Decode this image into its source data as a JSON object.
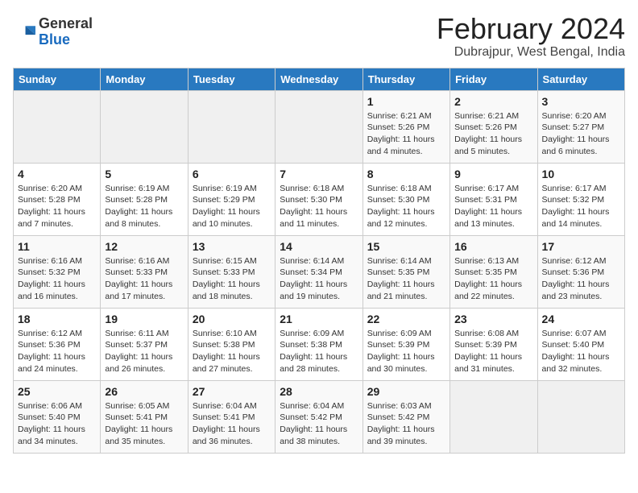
{
  "header": {
    "logo_general": "General",
    "logo_blue": "Blue",
    "title": "February 2024",
    "subtitle": "Dubrajpur, West Bengal, India"
  },
  "days_of_week": [
    "Sunday",
    "Monday",
    "Tuesday",
    "Wednesday",
    "Thursday",
    "Friday",
    "Saturday"
  ],
  "weeks": [
    [
      {
        "day": "",
        "info": ""
      },
      {
        "day": "",
        "info": ""
      },
      {
        "day": "",
        "info": ""
      },
      {
        "day": "",
        "info": ""
      },
      {
        "day": "1",
        "info": "Sunrise: 6:21 AM\nSunset: 5:26 PM\nDaylight: 11 hours and 4 minutes."
      },
      {
        "day": "2",
        "info": "Sunrise: 6:21 AM\nSunset: 5:26 PM\nDaylight: 11 hours and 5 minutes."
      },
      {
        "day": "3",
        "info": "Sunrise: 6:20 AM\nSunset: 5:27 PM\nDaylight: 11 hours and 6 minutes."
      }
    ],
    [
      {
        "day": "4",
        "info": "Sunrise: 6:20 AM\nSunset: 5:28 PM\nDaylight: 11 hours and 7 minutes."
      },
      {
        "day": "5",
        "info": "Sunrise: 6:19 AM\nSunset: 5:28 PM\nDaylight: 11 hours and 8 minutes."
      },
      {
        "day": "6",
        "info": "Sunrise: 6:19 AM\nSunset: 5:29 PM\nDaylight: 11 hours and 10 minutes."
      },
      {
        "day": "7",
        "info": "Sunrise: 6:18 AM\nSunset: 5:30 PM\nDaylight: 11 hours and 11 minutes."
      },
      {
        "day": "8",
        "info": "Sunrise: 6:18 AM\nSunset: 5:30 PM\nDaylight: 11 hours and 12 minutes."
      },
      {
        "day": "9",
        "info": "Sunrise: 6:17 AM\nSunset: 5:31 PM\nDaylight: 11 hours and 13 minutes."
      },
      {
        "day": "10",
        "info": "Sunrise: 6:17 AM\nSunset: 5:32 PM\nDaylight: 11 hours and 14 minutes."
      }
    ],
    [
      {
        "day": "11",
        "info": "Sunrise: 6:16 AM\nSunset: 5:32 PM\nDaylight: 11 hours and 16 minutes."
      },
      {
        "day": "12",
        "info": "Sunrise: 6:16 AM\nSunset: 5:33 PM\nDaylight: 11 hours and 17 minutes."
      },
      {
        "day": "13",
        "info": "Sunrise: 6:15 AM\nSunset: 5:33 PM\nDaylight: 11 hours and 18 minutes."
      },
      {
        "day": "14",
        "info": "Sunrise: 6:14 AM\nSunset: 5:34 PM\nDaylight: 11 hours and 19 minutes."
      },
      {
        "day": "15",
        "info": "Sunrise: 6:14 AM\nSunset: 5:35 PM\nDaylight: 11 hours and 21 minutes."
      },
      {
        "day": "16",
        "info": "Sunrise: 6:13 AM\nSunset: 5:35 PM\nDaylight: 11 hours and 22 minutes."
      },
      {
        "day": "17",
        "info": "Sunrise: 6:12 AM\nSunset: 5:36 PM\nDaylight: 11 hours and 23 minutes."
      }
    ],
    [
      {
        "day": "18",
        "info": "Sunrise: 6:12 AM\nSunset: 5:36 PM\nDaylight: 11 hours and 24 minutes."
      },
      {
        "day": "19",
        "info": "Sunrise: 6:11 AM\nSunset: 5:37 PM\nDaylight: 11 hours and 26 minutes."
      },
      {
        "day": "20",
        "info": "Sunrise: 6:10 AM\nSunset: 5:38 PM\nDaylight: 11 hours and 27 minutes."
      },
      {
        "day": "21",
        "info": "Sunrise: 6:09 AM\nSunset: 5:38 PM\nDaylight: 11 hours and 28 minutes."
      },
      {
        "day": "22",
        "info": "Sunrise: 6:09 AM\nSunset: 5:39 PM\nDaylight: 11 hours and 30 minutes."
      },
      {
        "day": "23",
        "info": "Sunrise: 6:08 AM\nSunset: 5:39 PM\nDaylight: 11 hours and 31 minutes."
      },
      {
        "day": "24",
        "info": "Sunrise: 6:07 AM\nSunset: 5:40 PM\nDaylight: 11 hours and 32 minutes."
      }
    ],
    [
      {
        "day": "25",
        "info": "Sunrise: 6:06 AM\nSunset: 5:40 PM\nDaylight: 11 hours and 34 minutes."
      },
      {
        "day": "26",
        "info": "Sunrise: 6:05 AM\nSunset: 5:41 PM\nDaylight: 11 hours and 35 minutes."
      },
      {
        "day": "27",
        "info": "Sunrise: 6:04 AM\nSunset: 5:41 PM\nDaylight: 11 hours and 36 minutes."
      },
      {
        "day": "28",
        "info": "Sunrise: 6:04 AM\nSunset: 5:42 PM\nDaylight: 11 hours and 38 minutes."
      },
      {
        "day": "29",
        "info": "Sunrise: 6:03 AM\nSunset: 5:42 PM\nDaylight: 11 hours and 39 minutes."
      },
      {
        "day": "",
        "info": ""
      },
      {
        "day": "",
        "info": ""
      }
    ]
  ]
}
